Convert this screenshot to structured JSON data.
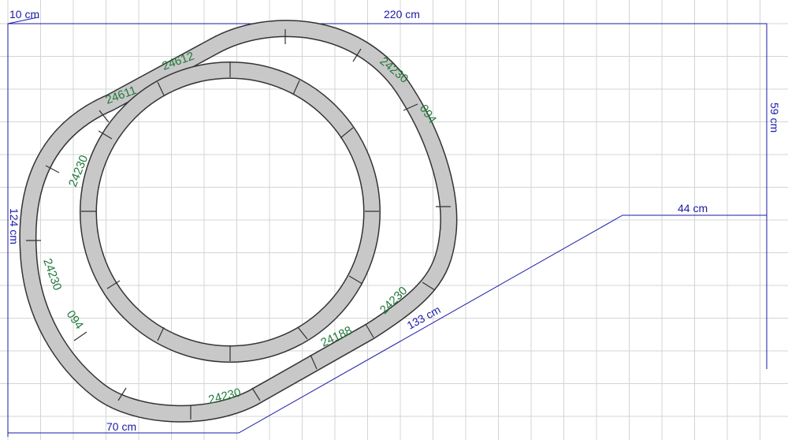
{
  "dimensions": {
    "offset_left": "10 cm",
    "width_total": "220 cm",
    "height_right": "59 cm",
    "height_left": "124 cm",
    "diagonal": "133 cm",
    "step_width": "44 cm",
    "bottom_width": "70 cm"
  },
  "pieces": {
    "top_left_1": "24612",
    "top_left_2": "24611",
    "top_right_1": "24230",
    "top_right_2": "094",
    "left_upper": "24230",
    "left_lower_1": "24230",
    "left_lower_2": "094",
    "bottom_1": "24230",
    "bottom_2": "24188",
    "bottom_3": "24230"
  },
  "colors": {
    "grid": "#d4d4d4",
    "dimension_line": "#1a1aa6",
    "track_fill": "#c8c8c8",
    "track_edge": "#333333",
    "label": "#1f7a3a"
  }
}
